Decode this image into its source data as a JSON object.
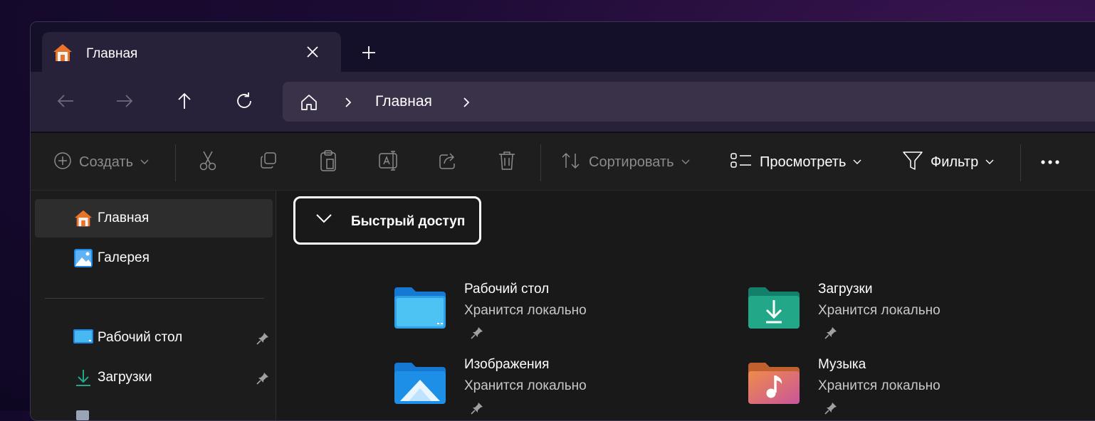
{
  "tab": {
    "title": "Главная"
  },
  "address": {
    "crumb": "Главная"
  },
  "toolbar": {
    "create_label": "Создать",
    "sort_label": "Сортировать",
    "view_label": "Просмотреть",
    "filter_label": "Фильтр"
  },
  "sidebar": {
    "items": [
      {
        "label": "Главная",
        "icon": "home-icon",
        "active": true
      },
      {
        "label": "Галерея",
        "icon": "gallery-icon"
      },
      {
        "label": "Рабочий стол",
        "icon": "desktop-icon",
        "pinned": true
      },
      {
        "label": "Загрузки",
        "icon": "downloads-icon",
        "pinned": true
      }
    ]
  },
  "quick_access": {
    "header": "Быстрый доступ",
    "items": [
      {
        "name": "Рабочий стол",
        "sub": "Хранится локально",
        "icon": "desktop-folder-icon"
      },
      {
        "name": "Загрузки",
        "sub": "Хранится локально",
        "icon": "downloads-folder-icon"
      },
      {
        "name": "Изображения",
        "sub": "Хранится локально",
        "icon": "pictures-folder-icon"
      },
      {
        "name": "Музыка",
        "sub": "Хранится локально",
        "icon": "music-folder-icon"
      }
    ]
  },
  "colors": {
    "accent": "#0078d4",
    "home_roof": "#e8732a",
    "downloads_green": "#22a889",
    "music_orange": "#e0784a"
  }
}
